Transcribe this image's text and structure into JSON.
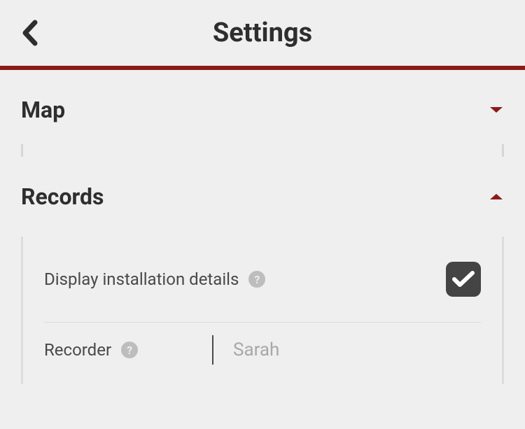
{
  "header": {
    "title": "Settings"
  },
  "sections": {
    "map": {
      "title": "Map",
      "expanded": false
    },
    "records": {
      "title": "Records",
      "expanded": true,
      "items": {
        "display_details": {
          "label": "Display installation details",
          "checked": true
        },
        "recorder": {
          "label": "Recorder",
          "value": "Sarah"
        }
      }
    }
  },
  "colors": {
    "accent": "#8b1a1a"
  }
}
